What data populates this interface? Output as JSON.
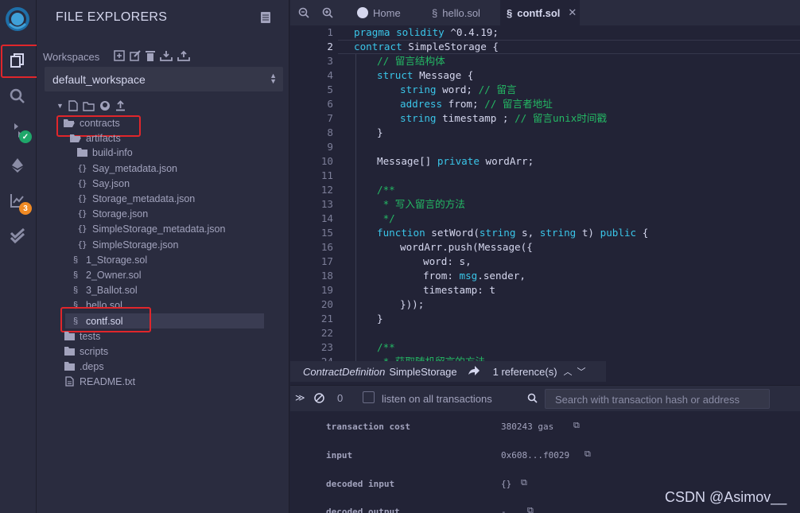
{
  "side": {
    "title": "FILE EXPLORERS",
    "workspaces_label": "Workspaces",
    "workspace_selected": "default_workspace"
  },
  "iconbar": {
    "solidity_badge": "3"
  },
  "tree": {
    "contracts": "contracts",
    "artifacts": "artifacts",
    "build_info": "build-info",
    "files_json": [
      "Say_metadata.json",
      "Say.json",
      "Storage_metadata.json",
      "Storage.json",
      "SimpleStorage_metadata.json",
      "SimpleStorage.json"
    ],
    "files_sol": [
      "1_Storage.sol",
      "2_Owner.sol",
      "3_Ballot.sol",
      "hello.sol",
      "contf.sol"
    ],
    "tests": "tests",
    "scripts": "scripts",
    "deps": ".deps",
    "readme": "README.txt"
  },
  "tabs": {
    "home": "Home",
    "hello": "hello.sol",
    "contf": "contf.sol"
  },
  "editor": {
    "line_numbers": [
      "1",
      "2",
      "3",
      "4",
      "5",
      "6",
      "7",
      "8",
      "9",
      "10",
      "11",
      "12",
      "13",
      "14",
      "15",
      "16",
      "17",
      "18",
      "19",
      "20",
      "21",
      "22",
      "23",
      "24"
    ],
    "code": {
      "l1_kw": "pragma solidity",
      "l1_rest": " ^0.4.19;",
      "l2_kw": "contract",
      "l2_rest": " SimpleStorage {",
      "l3": "// 留言结构体",
      "l4_kw": "struct",
      "l4_rest": " Message {",
      "l5_t": "string",
      "l5_r": " word; ",
      "l5_c": "// 留言",
      "l6_t": "address",
      "l6_r": " from; ",
      "l6_c": "// 留言者地址",
      "l7_t": "string",
      "l7_r": " timestamp ; ",
      "l7_c": "// 留言unix时间戳",
      "l8": "}",
      "l10_a": "Message[] ",
      "l10_k": "private",
      "l10_b": " wordArr;",
      "l12": "/**",
      "l13": " * 写入留言的方法",
      "l14": " */",
      "l15_k": "function",
      "l15_a": " setWord(",
      "l15_t1": "string",
      "l15_b": " s, ",
      "l15_t2": "string",
      "l15_c": " t) ",
      "l15_k2": "public",
      "l15_d": " {",
      "l16": "wordArr.push(Message({",
      "l17": "word: s,",
      "l18_a": "from: ",
      "l18_k": "msg",
      "l18_b": ".sender,",
      "l19": "timestamp: t",
      "l20": "}));",
      "l21": "}",
      "l23": "/**",
      "l24": " * 获取随机留言的方法"
    }
  },
  "refbar": {
    "kind": "ContractDefinition",
    "name": "SimpleStorage",
    "refs": "1 reference(s)"
  },
  "terminal": {
    "count": "0",
    "listen_label": "listen on all transactions",
    "search_placeholder": "Search with transaction hash or address",
    "rows": [
      {
        "key": "transaction cost",
        "value": "380243 gas"
      },
      {
        "key": "input",
        "value": "0x608...f0029"
      },
      {
        "key": "decoded input",
        "value": "{}"
      },
      {
        "key": "decoded output",
        "value": "-"
      }
    ]
  },
  "watermark": "CSDN @Asimov__"
}
